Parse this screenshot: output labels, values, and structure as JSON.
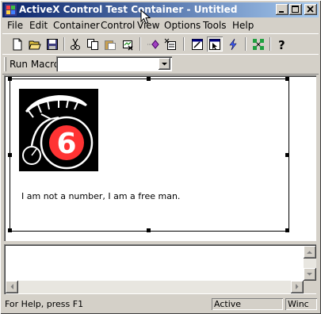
{
  "window": {
    "title": "ActiveX Control Test Container - Untitled",
    "controls": [
      "minimize",
      "maximize",
      "close"
    ]
  },
  "menu": [
    "File",
    "Edit",
    "Container",
    "Control",
    "View",
    "Options",
    "Tools",
    "Help"
  ],
  "toolbar": {
    "icons": [
      "new-file-icon",
      "open-folder-icon",
      "save-icon",
      "cut-icon",
      "copy-icon",
      "paste-icon",
      "delete-icon",
      "insert-control-icon",
      "properties-icon",
      "design-mode-icon",
      "run-mode-icon",
      "invoke-methods-icon",
      "connections-icon",
      "help-icon"
    ]
  },
  "macro": {
    "label": "Run Macro:",
    "value": ""
  },
  "control_display": {
    "logo_number": "6",
    "quote": "I am not a number, I am a free man."
  },
  "status": {
    "help_text": "For Help, press F1",
    "mode": "Active",
    "extra": "Winc"
  },
  "colors": {
    "title_start": "#0a246a",
    "title_end": "#a6caf0",
    "logo_circle": "#ff3333",
    "chrome": "#d4d0c8"
  }
}
